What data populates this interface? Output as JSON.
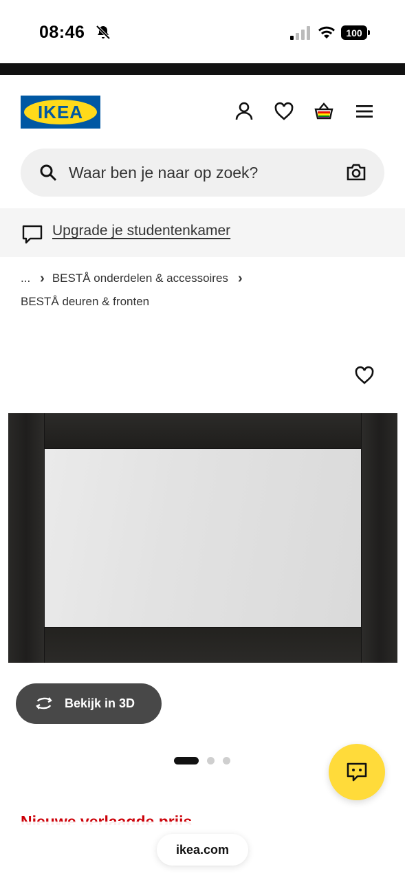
{
  "status_bar": {
    "time": "08:46",
    "battery": "100",
    "icons": [
      "bell-slash-icon",
      "signal-icon",
      "wifi-icon",
      "battery-icon"
    ]
  },
  "header": {
    "logo_text": "IKEA",
    "icons": [
      "account-icon",
      "heart-icon",
      "cart-icon",
      "menu-icon"
    ],
    "brand_colors": {
      "blue": "#0058a3",
      "yellow": "#ffda1a"
    }
  },
  "search": {
    "placeholder": "Waar ben je naar op zoek?",
    "value": ""
  },
  "promo": {
    "link_text": "Upgrade je studentenkamer"
  },
  "breadcrumb": {
    "ellipsis": "...",
    "level1": "BESTÅ onderdelen & accessoires",
    "current": "BESTÅ deuren & fronten"
  },
  "product": {
    "view_3d_label": "Bekijk in 3D",
    "image_count": 3,
    "active_image_index": 0,
    "price_heading": "Nieuwe verlaagde prijs",
    "price_color": "#cc0008"
  },
  "browser": {
    "url": "ikea.com"
  }
}
